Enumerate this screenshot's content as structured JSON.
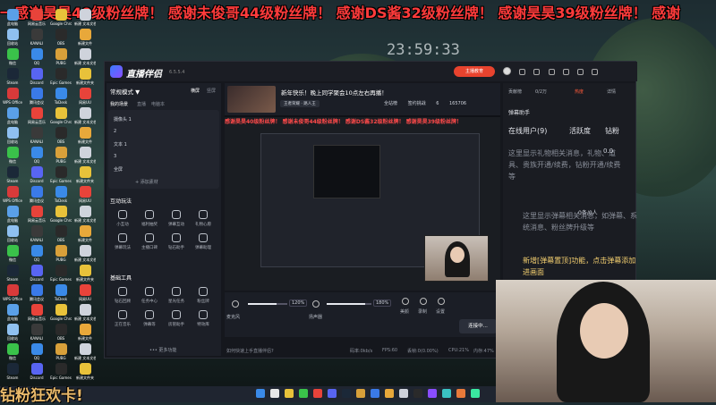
{
  "marquee": "一感谢昊昊40级粉丝牌！ 感谢未俊哥44级粉丝牌！ 感谢DS酱32级粉丝牌！ 感谢昊昊39级粉丝牌！ 感谢",
  "clock": "23:59:33",
  "bottom_banner": "钻粉狂欢卡!",
  "desktop_icons": [
    {
      "label": "此电脑",
      "color": "#5aa0e8"
    },
    {
      "label": "网易云音乐",
      "color": "#e8433a"
    },
    {
      "label": "Google Chrome",
      "color": "#e8c23a"
    },
    {
      "label": "新建 文本文档",
      "color": "#cfd3dc"
    },
    {
      "label": "回收站",
      "color": "#8fc0f0"
    },
    {
      "label": "KANALI",
      "color": "#3a3a3a"
    },
    {
      "label": "OBS",
      "color": "#2a2a2a"
    },
    {
      "label": "新建文件",
      "color": "#e8a83a"
    },
    {
      "label": "微信",
      "color": "#3ac24a"
    },
    {
      "label": "QQ",
      "color": "#3a8ae8"
    },
    {
      "label": "PUBG",
      "color": "#d8a03a"
    },
    {
      "label": "新建 文本文档",
      "color": "#cfd3dc"
    },
    {
      "label": "Steam",
      "color": "#1b2838"
    },
    {
      "label": "Discord",
      "color": "#5865f2"
    },
    {
      "label": "Epic Games",
      "color": "#2a2a2a"
    },
    {
      "label": "新建文件夹",
      "color": "#e8c23a"
    },
    {
      "label": "WPS Office",
      "color": "#d83a3a"
    },
    {
      "label": "腾讯会议",
      "color": "#3a7ae8"
    },
    {
      "label": "ToDesk",
      "color": "#3a8ae8"
    },
    {
      "label": "网易UU",
      "color": "#e8433a"
    }
  ],
  "app": {
    "name": "直播伴侣",
    "version": "6.5.5.4",
    "start_btn": "主播教育",
    "left": {
      "mode": "常规模式 ▼",
      "link1": "横屏",
      "link2": "竖屏",
      "tabs": [
        "我的场景",
        "直播",
        "电脑本"
      ],
      "scenes": [
        "摄像头 1",
        "2",
        "文本 1",
        "3",
        "全屏"
      ],
      "add_source": "+ 添加素材",
      "section_interactive": "互动玩法",
      "interactive": [
        "小互动",
        "福利抽奖",
        "弹幕互动",
        "礼物心愿",
        "弹幕玩法",
        "主播口碑",
        "钻石助手",
        "弹幕助理"
      ],
      "section_basic": "基础工具",
      "basic": [
        "钻石回顾",
        "任务中心",
        "星光任务",
        "粉丝牌",
        "正在音乐",
        "弹幕等",
        "房管助手",
        "特效库"
      ],
      "more": "••• 更多功能"
    },
    "preview": {
      "title": "新年快乐！晚上同学聚会10点左右再播！",
      "tag": "王者荣耀 · 路人王",
      "tools": [
        "全站榜",
        "签约挑战",
        "6",
        "165706"
      ],
      "inner_marquee": "感谢昊昊40级粉丝牌！ 感谢未俊哥44级粉丝牌！ 感谢DS酱32级粉丝牌！ 感谢昊昊39级粉丝牌！"
    },
    "controls": {
      "mic_label": "麦克风",
      "mic_pct": "120%",
      "speaker_label": "扬声器",
      "speaker_pct": "180%",
      "mic_level": 0.72,
      "speaker_level": 0.85,
      "effects": "美颜",
      "record": "录制",
      "settings": "设置",
      "start_live": "连接中..."
    },
    "status": {
      "help": "如何快速上手直播伴侣?",
      "bitrate": "码率:0kb/s",
      "fps": "FPS:60",
      "drop": "丢帧:0(0.00%)",
      "cpu": "CPU:21%",
      "mem": "内存:47%"
    },
    "right": {
      "tabs": [
        "贡献榜",
        "0/2万",
        "热度",
        "详情"
      ],
      "helper": "弹幕助手",
      "online": "在线用户(9)",
      "activity": "活跃度",
      "diamond": "钻粉",
      "gift_desc": "这里显示礼物相关消息，礼物、道具、贵族开通/续费，钻粉开通/续费等",
      "gift_count": "0.0",
      "danmu_count": "0条/0人",
      "danmu_desc": "这里显示弹幕相关消息，如弹幕、系统消息、粉丝牌升级等",
      "notice": "新增[弹幕置顶]功能，点击弹幕添加进画面"
    }
  }
}
